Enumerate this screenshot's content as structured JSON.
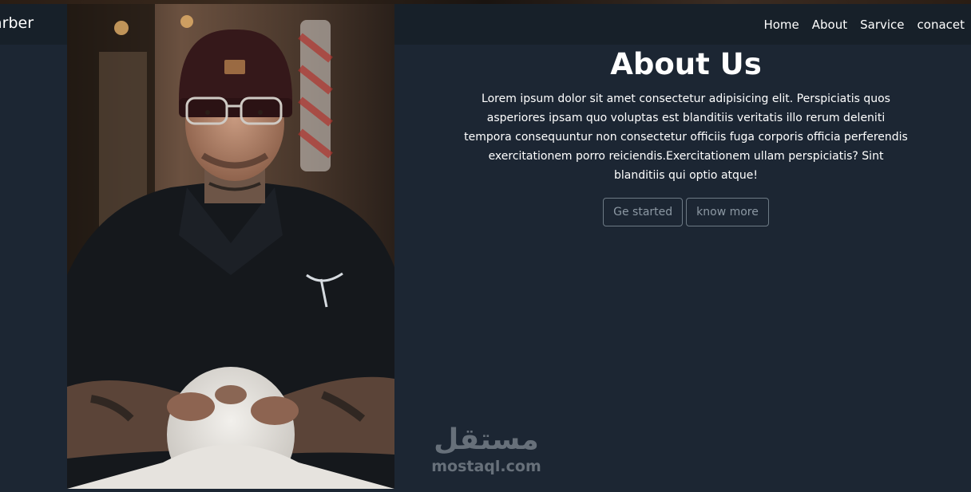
{
  "navbar": {
    "brand": "arber",
    "links": [
      "Home",
      "About",
      "Sarvice",
      "conacet"
    ]
  },
  "about": {
    "title": "About Us",
    "text": "Lorem ipsum dolor sit amet consectetur adipisicing elit. Perspiciatis quos asperiores ipsam quo voluptas est blanditiis veritatis illo rerum deleniti tempora consequuntur non consectetur officiis fuga corporis officia perferendis exercitationem porro reiciendis.Exercitationem ullam perspiciatis? Sint blanditiis qui optio atque!",
    "buttons": {
      "start": "Ge started",
      "more": "know more"
    }
  },
  "photo": {
    "subject": "barber-portrait-icon"
  },
  "watermark": {
    "arabic": "مستقل",
    "latin": "mostaql.com"
  },
  "colors": {
    "page_bg": "#1c2633",
    "navbar_bg": "#172029",
    "text": "#ffffff",
    "button_border": "#6d7a85",
    "button_text": "#8c98a3",
    "watermark": "#67707a"
  }
}
